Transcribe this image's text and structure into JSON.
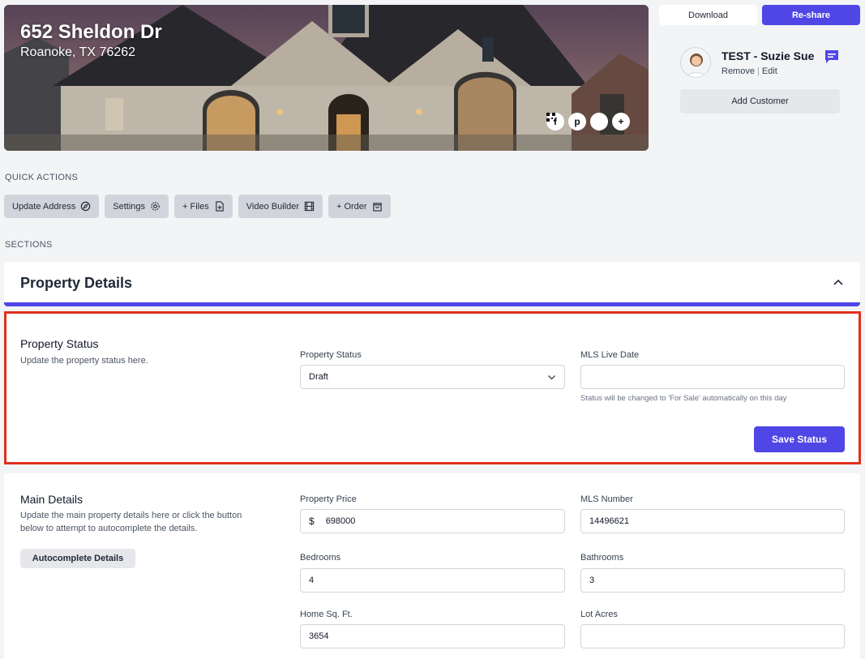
{
  "hero": {
    "address": "652 Sheldon Dr",
    "city": "Roanoke, TX 76262",
    "share_icons": [
      "facebook-icon",
      "pinterest-icon",
      "qr-code-icon",
      "plus-icon"
    ]
  },
  "top_actions": {
    "download_label": "Download",
    "reshare_label": "Re-share"
  },
  "customer": {
    "name": "TEST - Suzie Sue",
    "remove_label": "Remove",
    "separator": "|",
    "edit_label": "Edit",
    "add_label": "Add Customer"
  },
  "quick_actions": {
    "heading": "QUICK ACTIONS",
    "items": [
      {
        "label": "Update Address",
        "icon": "compass-icon"
      },
      {
        "label": "Settings",
        "icon": "gear-icon"
      },
      {
        "label": "+ Files",
        "icon": "file-plus-icon"
      },
      {
        "label": "Video Builder",
        "icon": "film-icon"
      },
      {
        "label": "+ Order",
        "icon": "bag-icon"
      }
    ]
  },
  "sections": {
    "heading": "SECTIONS",
    "property_details_title": "Property Details"
  },
  "status_card": {
    "title": "Property Status",
    "description": "Update the property status here.",
    "status_label": "Property Status",
    "status_value": "Draft",
    "mls_date_label": "MLS Live Date",
    "mls_date_value": "",
    "mls_hint": "Status will be changed to 'For Sale' automatically on this day",
    "save_label": "Save Status"
  },
  "main_card": {
    "title": "Main Details",
    "description_line1": "Update the main property details here or click the button",
    "description_line2": "below to attempt to autocomplete the details.",
    "autocomplete_label": "Autocomplete Details",
    "price_label": "Property Price",
    "price_prefix": "$",
    "price_value": "698000",
    "mls_number_label": "MLS Number",
    "mls_number_value": "14496621",
    "bedrooms_label": "Bedrooms",
    "bedrooms_value": "4",
    "bathrooms_label": "Bathrooms",
    "bathrooms_value": "3",
    "sqft_label": "Home Sq. Ft.",
    "sqft_value": "3654",
    "lot_label": "Lot Acres",
    "lot_value": ""
  },
  "colors": {
    "accent": "#4f46e5",
    "highlight_border": "#e0301e"
  }
}
